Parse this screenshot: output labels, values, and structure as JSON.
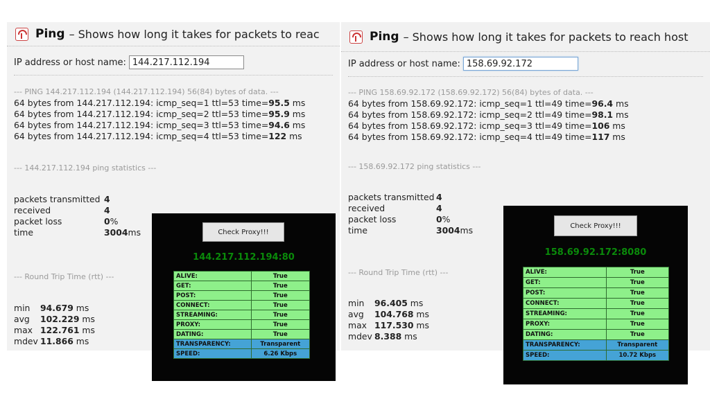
{
  "left": {
    "title": "Ping",
    "subtitle": "– Shows how long it takes for packets to reac",
    "host_label": "IP address or host name:",
    "host_value": "144.217.112.194",
    "ping_header": "--- PING 144.217.112.194 (144.217.112.194) 56(84) bytes of data. ---",
    "replies": [
      {
        "prefix": "64 bytes from 144.217.112.194: icmp_seq=1 ttl=53 time=",
        "time": "95.5",
        "unit": " ms"
      },
      {
        "prefix": "64 bytes from 144.217.112.194: icmp_seq=2 ttl=53 time=",
        "time": "95.9",
        "unit": " ms"
      },
      {
        "prefix": "64 bytes from 144.217.112.194: icmp_seq=3 ttl=53 time=",
        "time": "94.6",
        "unit": " ms"
      },
      {
        "prefix": "64 bytes from 144.217.112.194: icmp_seq=4 ttl=53 time=",
        "time": "122",
        "unit": " ms"
      }
    ],
    "stats_header": "--- 144.217.112.194 ping statistics ---",
    "stats": [
      {
        "label": "packets transmitted",
        "value": "4",
        "unit": ""
      },
      {
        "label": "received",
        "value": "4",
        "unit": ""
      },
      {
        "label": "packet loss",
        "value": "0",
        "unit": " %"
      },
      {
        "label": "time",
        "value": "3004",
        "unit": " ms"
      }
    ],
    "rtt_header": "--- Round Trip Time (rtt) ---",
    "rtt": [
      {
        "label": "min",
        "value": "94.679",
        "unit": " ms"
      },
      {
        "label": "avg",
        "value": "102.229",
        "unit": " ms"
      },
      {
        "label": "max",
        "value": "122.761",
        "unit": " ms"
      },
      {
        "label": "mdev",
        "value": "11.866",
        "unit": " ms"
      }
    ]
  },
  "right": {
    "title": "Ping",
    "subtitle": "– Shows how long it takes for packets to reach host",
    "host_label": "IP address or host name:",
    "host_value": "158.69.92.172",
    "ping_header": "--- PING 158.69.92.172 (158.69.92.172) 56(84) bytes of data. ---",
    "replies": [
      {
        "prefix": "64 bytes from 158.69.92.172: icmp_seq=1 ttl=49 time=",
        "time": "96.4",
        "unit": " ms"
      },
      {
        "prefix": "64 bytes from 158.69.92.172: icmp_seq=2 ttl=49 time=",
        "time": "98.1",
        "unit": " ms"
      },
      {
        "prefix": "64 bytes from 158.69.92.172: icmp_seq=3 ttl=49 time=",
        "time": "106",
        "unit": " ms"
      },
      {
        "prefix": "64 bytes from 158.69.92.172: icmp_seq=4 ttl=49 time=",
        "time": "117",
        "unit": " ms"
      }
    ],
    "stats_header": "--- 158.69.92.172 ping statistics ---",
    "stats": [
      {
        "label": "packets transmitted",
        "value": "4",
        "unit": ""
      },
      {
        "label": "received",
        "value": "4",
        "unit": ""
      },
      {
        "label": "packet loss",
        "value": "0",
        "unit": " %"
      },
      {
        "label": "time",
        "value": "3004",
        "unit": " ms"
      }
    ],
    "rtt_header": "--- Round Trip Time (rtt) ---",
    "rtt": [
      {
        "label": "min",
        "value": "96.405",
        "unit": " ms"
      },
      {
        "label": "avg",
        "value": "104.768",
        "unit": " ms"
      },
      {
        "label": "max",
        "value": "117.530",
        "unit": " ms"
      },
      {
        "label": "mdev",
        "value": "8.388",
        "unit": " ms"
      }
    ]
  },
  "proxy_left": {
    "button": "Check Proxy!!!",
    "address": "144.217.112.194:80",
    "rows": [
      {
        "key": "ALIVE:",
        "value": "True",
        "color": "green"
      },
      {
        "key": "GET:",
        "value": "True",
        "color": "green"
      },
      {
        "key": "POST:",
        "value": "True",
        "color": "green"
      },
      {
        "key": "CONNECT:",
        "value": "True",
        "color": "green"
      },
      {
        "key": "STREAMING:",
        "value": "True",
        "color": "green"
      },
      {
        "key": "PROXY:",
        "value": "True",
        "color": "green"
      },
      {
        "key": "DATING:",
        "value": "True",
        "color": "green"
      },
      {
        "key": "TRANSPARENCY:",
        "value": "Transparent",
        "color": "blue"
      },
      {
        "key": "SPEED:",
        "value": "6.26 Kbps",
        "color": "blue"
      }
    ]
  },
  "proxy_right": {
    "button": "Check Proxy!!!",
    "address": "158.69.92.172:8080",
    "rows": [
      {
        "key": "ALIVE:",
        "value": "True",
        "color": "green"
      },
      {
        "key": "GET:",
        "value": "True",
        "color": "green"
      },
      {
        "key": "POST:",
        "value": "True",
        "color": "green"
      },
      {
        "key": "CONNECT:",
        "value": "True",
        "color": "green"
      },
      {
        "key": "STREAMING:",
        "value": "True",
        "color": "green"
      },
      {
        "key": "PROXY:",
        "value": "True",
        "color": "green"
      },
      {
        "key": "DATING:",
        "value": "True",
        "color": "green"
      },
      {
        "key": "TRANSPARENCY:",
        "value": "Transparent",
        "color": "blue"
      },
      {
        "key": "SPEED:",
        "value": "10.72 Kbps",
        "color": "blue"
      }
    ]
  },
  "colors": {
    "panel_bg": "#f2f2f2",
    "proxy_bg": "#050505",
    "address_green": "#0a8a0a",
    "row_green": "#8ef08a",
    "row_blue": "#45a3d6"
  }
}
